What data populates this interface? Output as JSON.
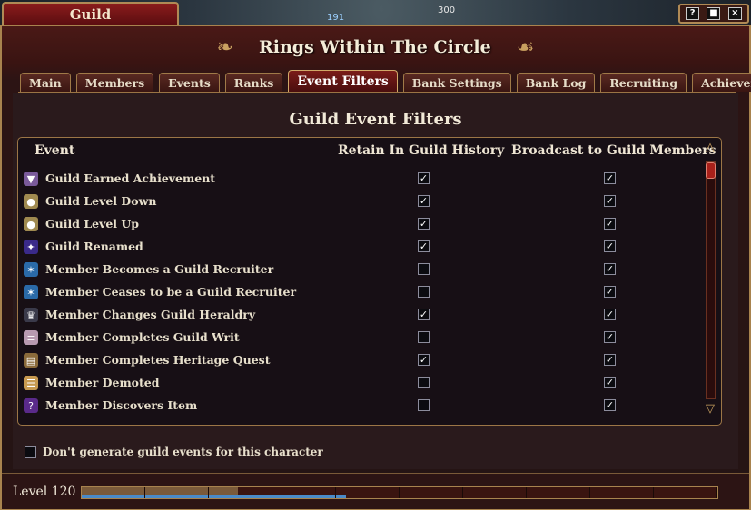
{
  "hud": {
    "num1": "300",
    "num2": "191"
  },
  "window_tab": {
    "label": "Guild"
  },
  "window_controls": [
    "?",
    "■",
    "×"
  ],
  "title": "Rings Within The Circle",
  "tabs": [
    {
      "label": "Main"
    },
    {
      "label": "Members"
    },
    {
      "label": "Events"
    },
    {
      "label": "Ranks"
    },
    {
      "label": "Event Filters",
      "active": true
    },
    {
      "label": "Bank Settings"
    },
    {
      "label": "Bank Log"
    },
    {
      "label": "Recruiting"
    },
    {
      "label": "Achievemen"
    }
  ],
  "section_title": "Guild Event Filters",
  "columns": {
    "event": "Event",
    "retain": "Retain In Guild History",
    "broadcast": "Broadcast to Guild Members"
  },
  "rows": [
    {
      "label": "Guild Earned Achievement",
      "icon": "achievement-icon",
      "retain": true,
      "broadcast": true
    },
    {
      "label": "Guild Level Down",
      "icon": "bag-icon",
      "retain": true,
      "broadcast": true
    },
    {
      "label": "Guild Level Up",
      "icon": "bag-icon",
      "retain": true,
      "broadcast": true
    },
    {
      "label": "Guild Renamed",
      "icon": "sparkle-icon",
      "retain": true,
      "broadcast": true
    },
    {
      "label": "Member Becomes a Guild Recruiter",
      "icon": "recruiter-icon",
      "retain": false,
      "broadcast": true
    },
    {
      "label": "Member Ceases to be a Guild Recruiter",
      "icon": "recruiter-icon",
      "retain": false,
      "broadcast": true
    },
    {
      "label": "Member Changes Guild Heraldry",
      "icon": "crown-icon",
      "retain": true,
      "broadcast": true
    },
    {
      "label": "Member Completes Guild Writ",
      "icon": "scroll-icon",
      "retain": false,
      "broadcast": true
    },
    {
      "label": "Member Completes Heritage Quest",
      "icon": "book-icon",
      "retain": true,
      "broadcast": true
    },
    {
      "label": "Member Demoted",
      "icon": "document-icon",
      "retain": false,
      "broadcast": true
    },
    {
      "label": "Member Discovers Item",
      "icon": "question-icon",
      "retain": false,
      "broadcast": true
    }
  ],
  "option": {
    "label": "Don't generate guild events for this character",
    "checked": false
  },
  "level": {
    "label": "Level 120",
    "xp_fraction": 0.245,
    "aa_fraction": 0.415
  },
  "colors": {
    "accent": "#a8834e",
    "active_tab": "#7a1c18",
    "xp_blue": "#4a8ac8"
  }
}
